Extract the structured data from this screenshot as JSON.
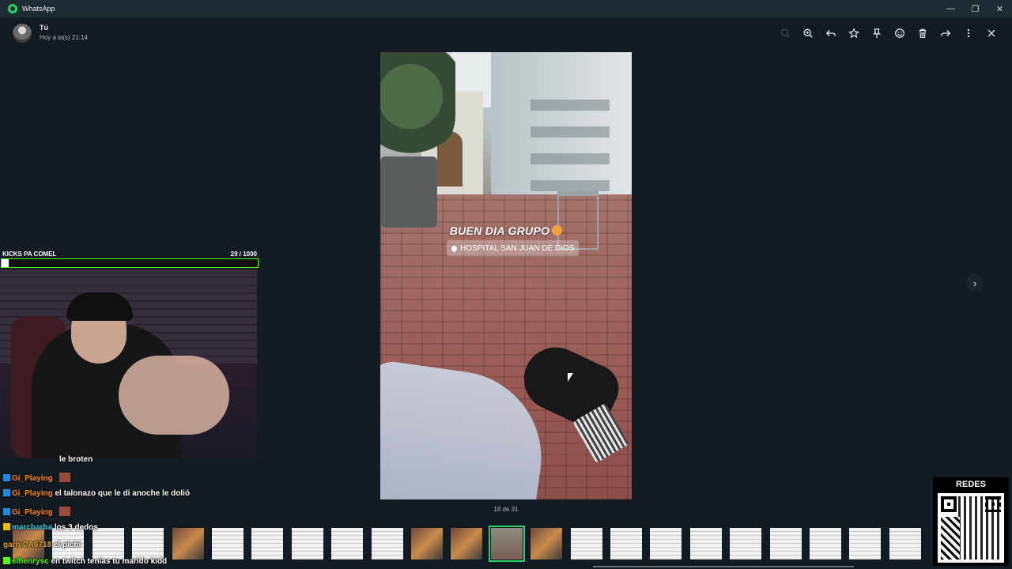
{
  "window": {
    "title": "WhatsApp",
    "controls": [
      "minimize-icon",
      "restore-icon",
      "close-icon"
    ]
  },
  "viewer": {
    "sender": "Tú",
    "timestamp": "Hoy a la(s) 21:14",
    "tools": [
      "search-icon",
      "zoom-in-icon",
      "reply-icon",
      "star-icon",
      "pin-icon",
      "react-icon",
      "delete-icon",
      "forward-icon",
      "menu-icon",
      "close-icon"
    ],
    "counter": "18 de 31"
  },
  "media": {
    "story_text": "BUEN DIA GRUPO",
    "location": "HOSPITAL SAN JUAN DE DIOS"
  },
  "stream_overlay": {
    "kicks_title": "KICKS PA COMEL",
    "kicks_count": "29  / 1000",
    "kicks_progress": 0.029,
    "chat": [
      {
        "user": "",
        "text": "le broten",
        "user_color": "#ffffff"
      },
      {
        "user": "Gi_Playing",
        "text": "",
        "user_color": "#ff8c1a",
        "badge": "blue",
        "emote": true
      },
      {
        "user": "Gi_Playing",
        "text": "el talonazo que le di anoche le dolió",
        "user_color": "#ff8c1a",
        "badge": "blue"
      },
      {
        "user": "Gi_Playing",
        "text": "",
        "user_color": "#ff8c1a",
        "badge": "blue",
        "emote": true
      },
      {
        "user": "marcbarba",
        "text": "los 3 dedos",
        "user_color": "#3ec6d8",
        "badge": "gold"
      },
      {
        "user": "garniCA6718",
        "text": "el pichi",
        "user_color": "#e3a33a",
        "badge": ""
      },
      {
        "user": "elhenrysc",
        "text": "en twitch tenías tu marido kidd",
        "user_color": "#53fc18",
        "badge": "green"
      }
    ],
    "qr_title": "REDES"
  },
  "thumbnails": {
    "count": 23,
    "selected_index": 12
  }
}
